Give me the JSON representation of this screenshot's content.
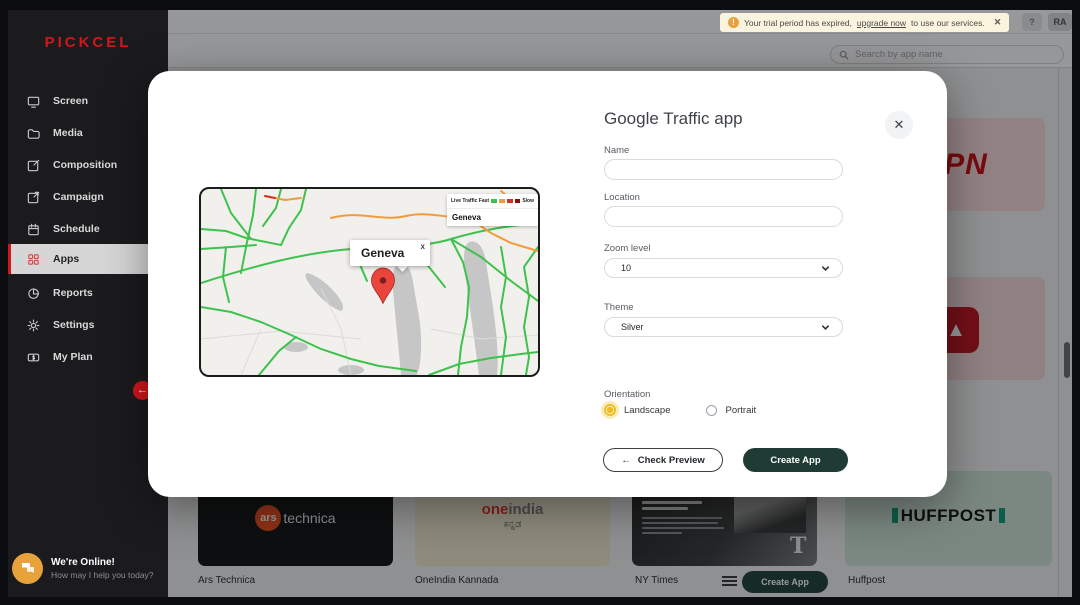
{
  "sidebar": {
    "logo_text": "PICKCEL",
    "items": [
      {
        "label": "Screen",
        "active": false
      },
      {
        "label": "Media",
        "active": false
      },
      {
        "label": "Composition",
        "active": false
      },
      {
        "label": "Campaign",
        "active": false
      },
      {
        "label": "Schedule",
        "active": false
      },
      {
        "label": "Apps",
        "active": true
      },
      {
        "label": "Reports",
        "active": false
      },
      {
        "label": "Settings",
        "active": false
      },
      {
        "label": "My Plan",
        "active": false
      }
    ]
  },
  "topbar": {
    "banner": {
      "warning_symbol": "!",
      "text_prefix": "Your trial period has expired,",
      "link_text": "upgrade now",
      "text_suffix": "to use our services.",
      "close_symbol": "✕"
    },
    "help_label": "?",
    "avatar_initials": "RA",
    "search_placeholder": "Search by app name"
  },
  "modal": {
    "title": "Google Traffic app",
    "close_symbol": "✕",
    "fields": {
      "name_label": "Name",
      "name_value": "",
      "location_label": "Location",
      "location_value": "",
      "zoom_label": "Zoom level",
      "zoom_value": "10",
      "theme_label": "Theme",
      "theme_value": "Silver",
      "orientation_label": "Orientation",
      "orientation_options": [
        {
          "label": "Landscape",
          "selected": true
        },
        {
          "label": "Portrait",
          "selected": false
        }
      ]
    },
    "buttons": {
      "check_preview": "Check Preview",
      "back_arrow": "←",
      "create_app": "Create App"
    },
    "map": {
      "info_window_title": "Geneva",
      "info_window_close": "x",
      "legend": {
        "fast_label": "Live Traffic Fast",
        "slow_label": "Slow",
        "location": "Geneva"
      }
    }
  },
  "background": {
    "cards": {
      "espn_logo": "ESPN",
      "rednews_glyph": "▲",
      "ars_logo_circle": "ars",
      "ars_logo_word": "technica",
      "oneindia_logo_one": "one",
      "oneindia_logo_india": "india",
      "oneindia_script": "ಕನ್ನಡ",
      "nyt_glyph": "T",
      "huffpost_logo": "HUFFPOST"
    },
    "labels": {
      "ars": "Ars Technica",
      "oneindia": "OneIndia Kannada",
      "nytimes": "NY Times",
      "huffpost": "Huffpost"
    },
    "nyt_action": "Create App"
  },
  "chat": {
    "title": "We're Online!",
    "subtitle": "How may I help you today?"
  },
  "colors": {
    "accent_red": "#d2161c",
    "create_button_green": "#1e3c34",
    "radio_selected_yellow": "#f0bd1f",
    "banner_bg": "#faf3dd",
    "traffic_fast": "#3ec24d",
    "traffic_medium": "#f29b38",
    "traffic_slow": "#d93025",
    "traffic_very_slow": "#7f120b"
  }
}
